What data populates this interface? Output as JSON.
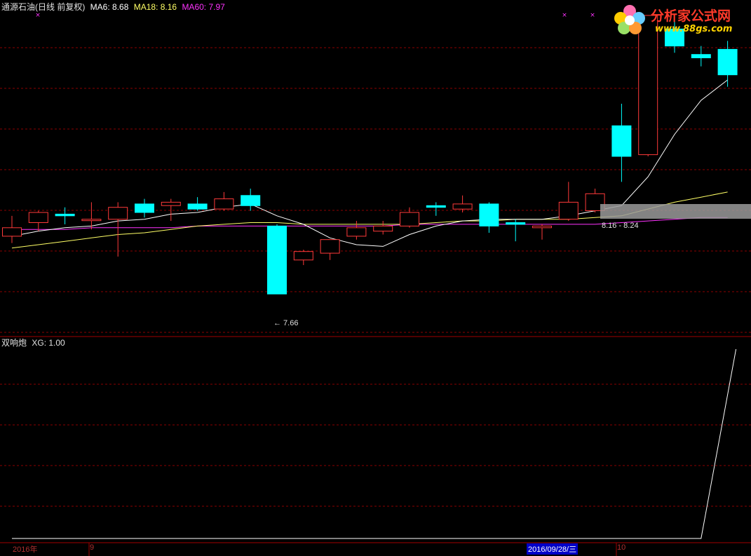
{
  "main_panel": {
    "title": "通源石油(日线 前复权)",
    "ma6_label": "MA6: 8.68",
    "ma18_label": "MA18: 8.16",
    "ma60_label": "MA60: 7.97",
    "range_label": "8.16 - 8.24",
    "low_label": "← 7.66"
  },
  "sub_panel": {
    "title": "双响炮",
    "xg_label": "XG: 1.00"
  },
  "date_axis": {
    "start": "2016年",
    "month1": "9",
    "cursor": "2016/09/28/三",
    "month2": "10"
  },
  "logo": {
    "text": "分析家公式网",
    "url": "www.88gs.com"
  },
  "colors": {
    "up": "#ff3a3a",
    "down": "#00ffff",
    "ma6": "#ffffff",
    "ma18": "#ffff66",
    "ma60": "#ff33ff",
    "grid": "#8b0000",
    "xg": "#ffffff"
  },
  "chart_data": {
    "type": "candlestick",
    "ylim": [
      7.5,
      9.3
    ],
    "candles": [
      {
        "o": 8.0,
        "h": 8.12,
        "l": 7.96,
        "c": 8.05
      },
      {
        "o": 8.08,
        "h": 8.15,
        "l": 8.03,
        "c": 8.14
      },
      {
        "o": 8.13,
        "h": 8.17,
        "l": 8.07,
        "c": 8.12
      },
      {
        "o": 8.1,
        "h": 8.2,
        "l": 8.04,
        "c": 8.1
      },
      {
        "o": 8.1,
        "h": 8.2,
        "l": 7.88,
        "c": 8.17
      },
      {
        "o": 8.19,
        "h": 8.22,
        "l": 8.11,
        "c": 8.14
      },
      {
        "o": 8.18,
        "h": 8.22,
        "l": 8.09,
        "c": 8.2
      },
      {
        "o": 8.19,
        "h": 8.23,
        "l": 8.15,
        "c": 8.16
      },
      {
        "o": 8.16,
        "h": 8.26,
        "l": 8.15,
        "c": 8.22
      },
      {
        "o": 8.24,
        "h": 8.28,
        "l": 8.15,
        "c": 8.18
      },
      {
        "o": 8.06,
        "h": 8.07,
        "l": 7.66,
        "c": 7.66
      },
      {
        "o": 7.86,
        "h": 7.92,
        "l": 7.83,
        "c": 7.91
      },
      {
        "o": 7.9,
        "h": 7.98,
        "l": 7.86,
        "c": 7.98
      },
      {
        "o": 8.0,
        "h": 8.09,
        "l": 7.98,
        "c": 8.05
      },
      {
        "o": 8.03,
        "h": 8.09,
        "l": 8.01,
        "c": 8.06
      },
      {
        "o": 8.06,
        "h": 8.17,
        "l": 8.05,
        "c": 8.14
      },
      {
        "o": 8.18,
        "h": 8.2,
        "l": 8.12,
        "c": 8.17
      },
      {
        "o": 8.16,
        "h": 8.24,
        "l": 8.14,
        "c": 8.19
      },
      {
        "o": 8.19,
        "h": 8.2,
        "l": 8.02,
        "c": 8.06
      },
      {
        "o": 8.08,
        "h": 8.1,
        "l": 7.97,
        "c": 8.07
      },
      {
        "o": 8.05,
        "h": 8.07,
        "l": 7.98,
        "c": 8.06
      },
      {
        "o": 8.1,
        "h": 8.32,
        "l": 8.09,
        "c": 8.2
      },
      {
        "o": 8.15,
        "h": 8.28,
        "l": 8.14,
        "c": 8.25
      },
      {
        "o": 8.65,
        "h": 8.78,
        "l": 8.32,
        "c": 8.47
      },
      {
        "o": 8.48,
        "h": 9.3,
        "l": 8.47,
        "c": 9.3
      },
      {
        "o": 9.22,
        "h": 9.3,
        "l": 9.08,
        "c": 9.12
      },
      {
        "o": 9.07,
        "h": 9.12,
        "l": 9.0,
        "c": 9.05
      },
      {
        "o": 9.1,
        "h": 9.15,
        "l": 8.88,
        "c": 8.95
      }
    ],
    "ma6": [
      8.0,
      8.03,
      8.05,
      8.06,
      8.09,
      8.1,
      8.13,
      8.14,
      8.17,
      8.19,
      8.12,
      8.07,
      7.99,
      7.95,
      7.94,
      8.01,
      8.06,
      8.09,
      8.1,
      8.1,
      8.1,
      8.12,
      8.15,
      8.18,
      8.35,
      8.6,
      8.8,
      8.92
    ],
    "ma18": [
      7.93,
      7.95,
      7.97,
      7.99,
      8.01,
      8.02,
      8.04,
      8.06,
      8.07,
      8.08,
      8.08,
      8.07,
      8.07,
      8.07,
      8.07,
      8.07,
      8.08,
      8.09,
      8.09,
      8.1,
      8.1,
      8.1,
      8.11,
      8.12,
      8.16,
      8.2,
      8.23,
      8.26
    ],
    "ma60": [
      8.04,
      8.04,
      8.04,
      8.05,
      8.05,
      8.05,
      8.05,
      8.06,
      8.06,
      8.06,
      8.06,
      8.06,
      8.06,
      8.06,
      8.06,
      8.07,
      8.07,
      8.07,
      8.07,
      8.07,
      8.07,
      8.07,
      8.07,
      8.08,
      8.09,
      8.1,
      8.11,
      8.11
    ],
    "xg": [
      0,
      0,
      0,
      0,
      0,
      0,
      0,
      0,
      0,
      0,
      0,
      0,
      0,
      0,
      0,
      0,
      0,
      0,
      0,
      0,
      0,
      0,
      0,
      0,
      0,
      0,
      0,
      1
    ],
    "xg_ylim": [
      0,
      1
    ]
  }
}
